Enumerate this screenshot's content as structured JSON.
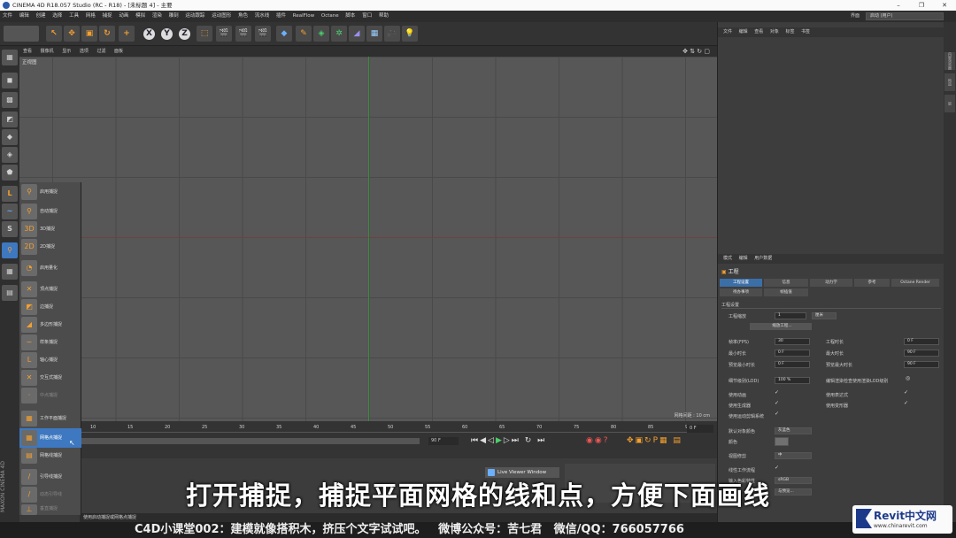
{
  "window": {
    "title": "CINEMA 4D R18.057 Studio (RC - R18) - [未标题 4] - 主要"
  },
  "menubar": {
    "items": [
      "文件",
      "编辑",
      "创建",
      "选择",
      "工具",
      "网格",
      "捕捉",
      "动画",
      "模拟",
      "渲染",
      "雕刻",
      "运动跟踪",
      "运动图形",
      "角色",
      "流水线",
      "插件",
      "RealFlow",
      "Octane",
      "脚本",
      "窗口",
      "帮助"
    ],
    "layout_label": "界面",
    "layout_value": "启动 (用户)"
  },
  "viewport": {
    "menu": [
      "查看",
      "摄像机",
      "显示",
      "选项",
      "过滤",
      "面板"
    ],
    "view_label": "正视图",
    "grid_info": "网格间距 : 10 cm"
  },
  "snap_menu": {
    "items": [
      {
        "label": "启用捕捉",
        "icon": "snap-magnet-icon",
        "state": "normal"
      },
      {
        "label": "自动捕捉",
        "icon": "auto-snap-icon",
        "state": "normal"
      },
      {
        "label": "3D捕捉",
        "icon": "3d-snap-icon",
        "state": "normal"
      },
      {
        "label": "2D捕捉",
        "icon": "2d-snap-icon",
        "state": "normal"
      },
      {
        "label": "启用量化",
        "icon": "quantize-icon",
        "state": "normal"
      },
      {
        "label": "顶点捕捉",
        "icon": "vertex-snap-icon",
        "state": "normal"
      },
      {
        "label": "边捕捉",
        "icon": "edge-snap-icon",
        "state": "normal"
      },
      {
        "label": "多边形捕捉",
        "icon": "polygon-snap-icon",
        "state": "normal"
      },
      {
        "label": "样条捕捉",
        "icon": "spline-snap-icon",
        "state": "normal"
      },
      {
        "label": "轴心捕捉",
        "icon": "axis-snap-icon",
        "state": "normal"
      },
      {
        "label": "交互式捕捉",
        "icon": "intersection-snap-icon",
        "state": "normal"
      },
      {
        "label": "中点捕捉",
        "icon": "midpoint-snap-icon",
        "state": "dim"
      },
      {
        "label": "工作平面捕捉",
        "icon": "workplane-snap-icon",
        "state": "normal"
      },
      {
        "label": "网格点捕捉",
        "icon": "grid-point-snap-icon",
        "state": "highlighted"
      },
      {
        "label": "网格线捕捉",
        "icon": "grid-line-snap-icon",
        "state": "normal"
      },
      {
        "label": "引导线捕捉",
        "icon": "guide-snap-icon",
        "state": "normal"
      },
      {
        "label": "动态引导线",
        "icon": "dynamic-guide-icon",
        "state": "dim"
      },
      {
        "label": "垂直捕捉",
        "icon": "perpendicular-snap-icon",
        "state": "dim"
      }
    ]
  },
  "timeline": {
    "ruler": [
      "10",
      "15",
      "20",
      "25",
      "30",
      "35",
      "40",
      "45",
      "50",
      "55",
      "60",
      "65",
      "70",
      "75",
      "80",
      "85",
      "90"
    ],
    "current_frame": "0 F",
    "end_frame": "90 F"
  },
  "right_panel": {
    "obj_menu": [
      "文件",
      "编辑",
      "查看",
      "对象",
      "标签",
      "书签"
    ],
    "attr_menu": [
      "模式",
      "编辑",
      "用户数据"
    ],
    "attr_title": "工程",
    "tabs_row1": [
      "工程设置",
      "信息",
      "动力学",
      "参考",
      "Octane Render"
    ],
    "tabs_row2": [
      "待办事项",
      "帧插值"
    ],
    "section": "工程设置",
    "scale_label": "工程缩放",
    "scale_value": "1",
    "scale_unit": "厘米",
    "scale_button": "缩放工程...",
    "fps_label": "帧率(FPS)",
    "fps_value": "30",
    "duration_label": "工程时长",
    "duration_value": "0 F",
    "min_time_label": "最小时长",
    "min_time_value": "0 F",
    "max_time_label": "最大时长",
    "max_time_value": "90 F",
    "prev_min_label": "预览最小时长",
    "prev_min_value": "0 F",
    "prev_max_label": "预览最大时长",
    "prev_max_value": "90 F",
    "lod_label": "细节级别(LOD)",
    "lod_value": "100 %",
    "lod_render_label": "编辑渲染检查使用渲染LOD级别",
    "anim_label": "使用动画",
    "expr_label": "使用表达式",
    "gen_label": "使用生成器",
    "deform_label": "使用变形器",
    "motion_label": "使用运动剪辑系统",
    "default_color_label": "默认对象颜色",
    "default_color_value": "灰蓝色",
    "color_label": "颜色",
    "view_clip_label": "视图修剪",
    "view_clip_value": "中",
    "linear_label": "线性工作流程",
    "input_color_label": "输入色彩特性",
    "input_color_value": "sRGB",
    "node_label": "节点",
    "node_value": "与预览...",
    "right_tabs": [
      "内容浏览器",
      "构造",
      "层"
    ]
  },
  "status": {
    "text": "使用启动捕捉或网格点捕捉"
  },
  "live_viewer": {
    "label": "Live Viewer Window"
  },
  "subtitle": {
    "text": "打开捕捉，捕捉平面网格的线和点，方便下面画线"
  },
  "footer": {
    "text": "C4D小课堂002：建模就像搭积木，挤压个文字试试吧。   微博公众号：苦七君   微信/QQ：766057766"
  },
  "logo": {
    "big": "Revit中文网",
    "small": "www.chinarevit.com"
  },
  "side_brand": {
    "text": "MAXON CINEMA 4D"
  }
}
